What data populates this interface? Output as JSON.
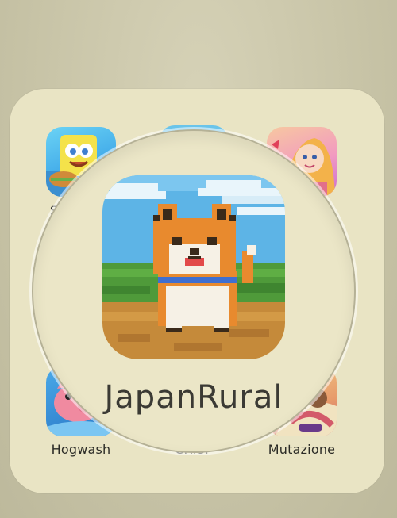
{
  "folder": {
    "apps": [
      {
        "id": "spongebob",
        "label": "S",
        "icon": "spongebob-game-icon"
      },
      {
        "id": "topmid",
        "label": "",
        "icon": "app-icon"
      },
      {
        "id": "princess",
        "label": "",
        "icon": "princess-game-icon"
      },
      {
        "id": "hogwash",
        "label": "Hogwash",
        "icon": "pig-game-icon"
      },
      {
        "id": "crisp",
        "label": "CRISP",
        "icon": "app-icon"
      },
      {
        "id": "mutazione",
        "label": "Mutazione",
        "icon": "mutazione-game-icon"
      }
    ]
  },
  "magnifier": {
    "app_name": "JapanRural",
    "icon": "shiba-dog-pixel-icon"
  }
}
